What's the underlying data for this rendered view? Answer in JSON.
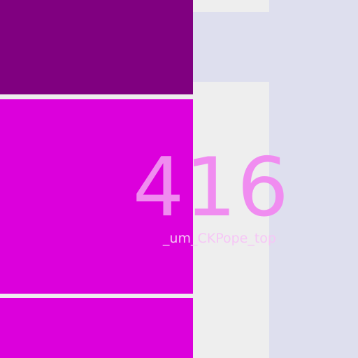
{
  "colors": {
    "background": "#eeeeee",
    "lavender_panel": "#dedfee",
    "tile_dark_purple": "#800080",
    "tile_magenta": "#dc00dc",
    "value_text": "#f08cf0",
    "caption_text": "#f6c6f6"
  },
  "metric_tile": {
    "value": "416",
    "caption": "_um_CKPope_top"
  }
}
